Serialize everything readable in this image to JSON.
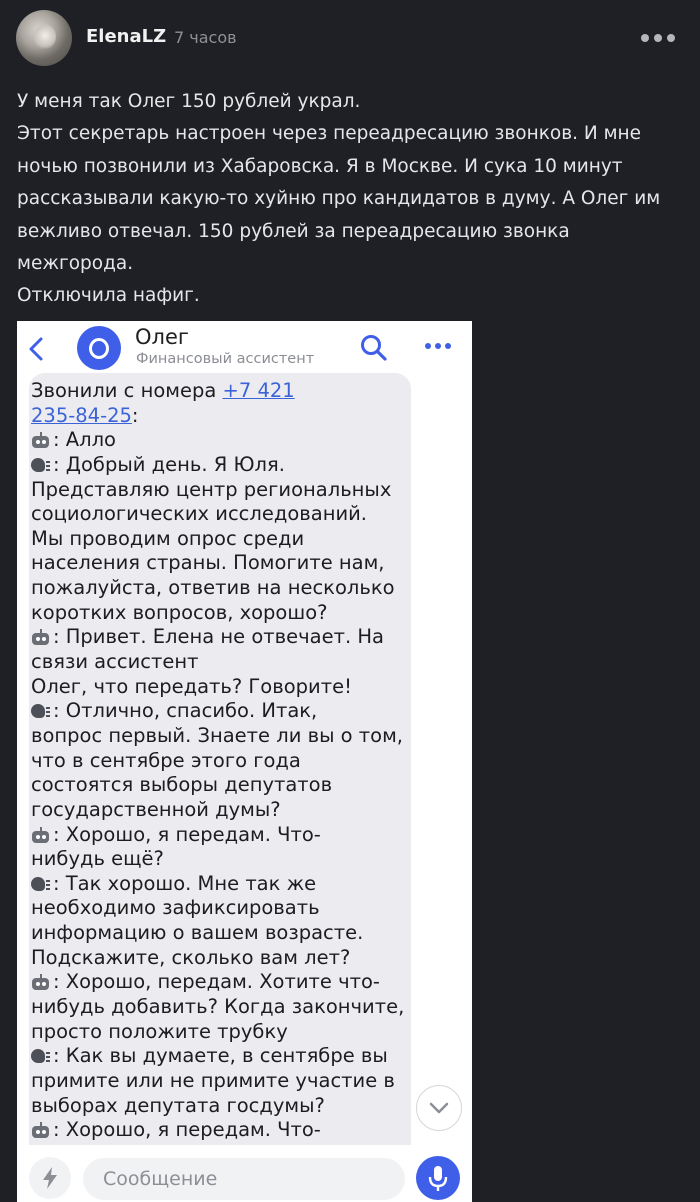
{
  "post": {
    "username": "ElenaLZ",
    "time": "7 часов",
    "lines": [
      "У меня так Олег 150 рублей украл.",
      "Этот секретарь настроен через переадресацию звонков. И мне",
      "ночью позвонили из Хабаровска. Я в Москве. И сука 10 минут",
      "рассказывали какую-то хуйню про кандидатов в думу. А Олег им",
      "вежливо отвечал. 150 рублей за переадресацию звонка",
      "межгорода.",
      "Отключила нафиг."
    ]
  },
  "embedded_chat": {
    "contact_name": "Олег",
    "contact_subtitle": "Финансовый ассистент",
    "message_lines": [
      {
        "type": "plain",
        "text": "Звонили с номера ",
        "link": "+7 421"
      },
      {
        "type": "link_end",
        "link": "235-84-25",
        "text": ":"
      },
      {
        "type": "robot",
        "text": ":  Алло"
      },
      {
        "type": "speaker",
        "text": ":  Добрый день. Я Юля."
      },
      {
        "type": "plain",
        "text": "Представляю центр региональных"
      },
      {
        "type": "plain",
        "text": "социологических исследований."
      },
      {
        "type": "plain",
        "text": "Мы проводим опрос среди"
      },
      {
        "type": "plain",
        "text": "населения страны. Помогите нам,"
      },
      {
        "type": "plain",
        "text": "пожалуйста, ответив на несколько"
      },
      {
        "type": "plain",
        "text": "коротких вопросов, хорошо?"
      },
      {
        "type": "robot",
        "text": ":  Привет. Елена не отвечает. На"
      },
      {
        "type": "plain",
        "text": "связи ассистент"
      },
      {
        "type": "plain",
        "text": "Олег, что передать? Говорите!"
      },
      {
        "type": "speaker",
        "text": ":  Отлично, спасибо. Итак,"
      },
      {
        "type": "plain",
        "text": "вопрос первый. Знаете ли вы о том,"
      },
      {
        "type": "plain",
        "text": "что в сентябре этого года"
      },
      {
        "type": "plain",
        "text": "состоятся выборы депутатов"
      },
      {
        "type": "plain",
        "text": "государственной думы?"
      },
      {
        "type": "robot",
        "text": ":  Хорошо, я передам. Что-"
      },
      {
        "type": "plain",
        "text": "нибудь ещё?"
      },
      {
        "type": "speaker",
        "text": ":  Так хорошо. Мне так же"
      },
      {
        "type": "plain",
        "text": "необходимо зафиксировать"
      },
      {
        "type": "plain",
        "text": "информацию о вашем возрасте."
      },
      {
        "type": "plain",
        "text": "Подскажите, сколько вам лет?"
      },
      {
        "type": "robot",
        "text": ":  Хорошо, передам. Хотите что-"
      },
      {
        "type": "plain",
        "text": "нибудь добавить? Когда закончите,"
      },
      {
        "type": "plain",
        "text": "просто положите трубку"
      },
      {
        "type": "speaker",
        "text": ":  Как вы думаете, в сентябре вы"
      },
      {
        "type": "plain",
        "text": "примите или не примите участие в"
      },
      {
        "type": "plain",
        "text": "выборах депутата госдумы?"
      },
      {
        "type": "robot",
        "text": ":  Хорошо, я передам. Что-"
      }
    ],
    "input_placeholder": "Сообщение"
  },
  "colors": {
    "background": "#1e2025",
    "accent": "#3f5fe8",
    "link": "#3b63d8"
  },
  "icons": [
    "more-icon",
    "back-icon",
    "search-icon",
    "dots-icon",
    "robot-icon",
    "speaker-icon",
    "chevron-down-icon",
    "lightning-icon",
    "microphone-icon"
  ]
}
